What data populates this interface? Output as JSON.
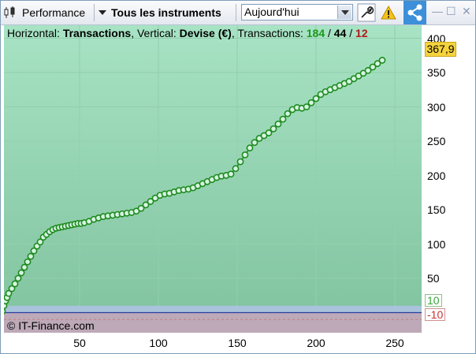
{
  "toolbar": {
    "performance_label": "Performance",
    "instruments_label": "Tous les instruments",
    "period_value": "Aujourd'hui"
  },
  "header": {
    "horizontal_label": "Horizontal:",
    "horizontal_value": "Transactions",
    "vertical_label": "Vertical:",
    "vertical_value": "Devise (€)",
    "transactions_label": "Transactions:",
    "count_total": "184",
    "slash1": "/",
    "count_mid": "44",
    "slash2": "/",
    "count_loss": "12"
  },
  "copyright": "© IT-Finance.com",
  "axis": {
    "y_ticks": [
      "400",
      "350",
      "300",
      "250",
      "200",
      "150",
      "100",
      "50"
    ],
    "x_ticks": [
      "50",
      "100",
      "150",
      "200",
      "250"
    ],
    "last_value": "367,9",
    "upper_band": "10",
    "lower_band": "-10"
  },
  "colors": {
    "accent": "#3c8fd8",
    "series": "#1e8a1e",
    "plot_top": "#a7e3c4",
    "plot_bottom": "#80c29e"
  },
  "chart_data": {
    "type": "line",
    "x": [
      1,
      2,
      3,
      4,
      5,
      7,
      9,
      11,
      13,
      15,
      17,
      19,
      21,
      23,
      25,
      27,
      29,
      31,
      33,
      35,
      37,
      39,
      41,
      43,
      45,
      47,
      49,
      51,
      53,
      56,
      59,
      62,
      65,
      68,
      71,
      74,
      77,
      80,
      83,
      86,
      89,
      92,
      95,
      98,
      101,
      104,
      107,
      110,
      113,
      116,
      119,
      122,
      125,
      128,
      131,
      134,
      137,
      140,
      143,
      146,
      149,
      152,
      155,
      158,
      161,
      164,
      167,
      170,
      173,
      176,
      179,
      182,
      185,
      188,
      191,
      194,
      197,
      200,
      203,
      206,
      209,
      212,
      215,
      218,
      221,
      224,
      227,
      230,
      233,
      236,
      239,
      242
    ],
    "y": [
      2,
      10,
      17,
      22,
      28,
      35,
      42,
      50,
      58,
      66,
      74,
      82,
      90,
      97,
      103,
      110,
      114,
      118,
      121,
      123,
      124,
      125,
      126,
      127,
      128,
      129,
      130,
      130,
      131,
      133,
      136,
      138,
      140,
      141,
      142,
      143,
      144,
      145,
      146,
      148,
      152,
      157,
      162,
      167,
      171,
      173,
      174,
      176,
      178,
      179,
      180,
      182,
      185,
      188,
      191,
      194,
      197,
      199,
      200,
      202,
      210,
      220,
      230,
      240,
      248,
      254,
      258,
      262,
      268,
      275,
      282,
      290,
      296,
      299,
      298,
      300,
      306,
      312,
      318,
      322,
      325,
      328,
      331,
      334,
      337,
      341,
      345,
      349,
      353,
      358,
      363,
      367.9
    ],
    "xlabel": "Transactions",
    "ylabel": "Devise (€)",
    "xlim": [
      0,
      265
    ],
    "ylim": [
      -20,
      400
    ],
    "loss_segments": [
      [
        120,
        182,
        125,
        185
      ]
    ],
    "grid": true
  }
}
